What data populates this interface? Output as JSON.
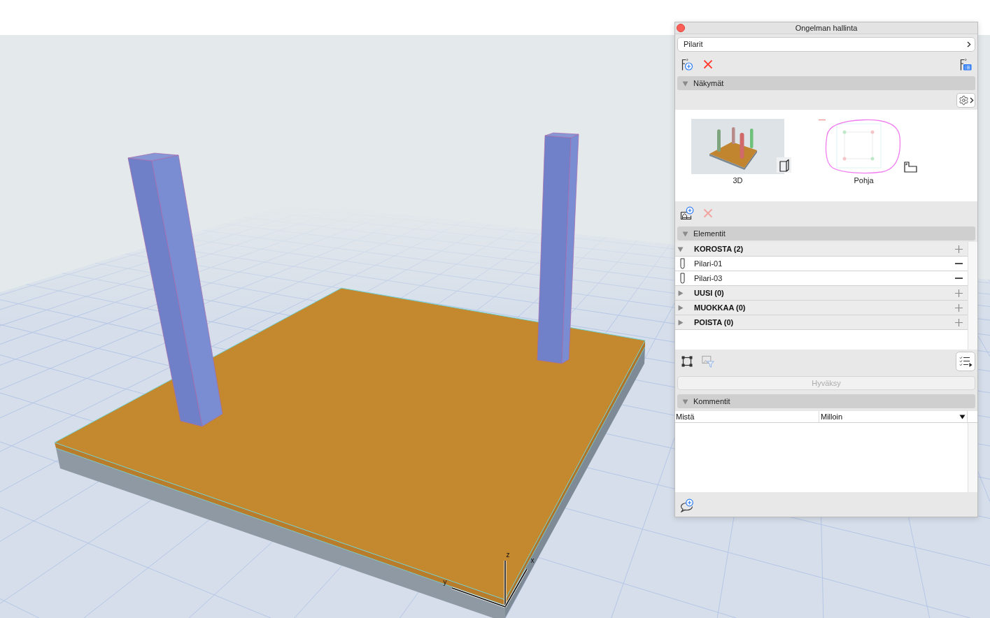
{
  "viewport": {
    "axes": [
      {
        "kind": "z",
        "label": "z"
      },
      {
        "kind": "x",
        "label": "x"
      },
      {
        "kind": "y",
        "label": "y"
      }
    ]
  },
  "panel": {
    "title": "Ongelman hallinta",
    "issue_field": {
      "value": "Pilarit"
    },
    "issue_toolbar": [
      {
        "kind": "new",
        "disabled": false
      },
      {
        "kind": "delete",
        "disabled": false
      },
      {
        "kind": "list",
        "disabled": false
      }
    ],
    "views_section": {
      "title": "Näkymät",
      "expanded": true,
      "views": [
        {
          "kind": "model",
          "label": "3D",
          "selected": false
        },
        {
          "kind": "plan",
          "label": "Pohja",
          "selected": false
        }
      ],
      "toolbar": [
        {
          "kind": "add",
          "disabled": false
        },
        {
          "kind": "delete",
          "disabled": true
        }
      ]
    },
    "elements_section": {
      "title": "Elementit",
      "expanded": true,
      "groups": [
        {
          "label": "KOROSTA (2)",
          "expanded": true,
          "children": [
            {
              "label": "Pilari-01",
              "selected": false
            },
            {
              "label": "Pilari-03",
              "selected": false
            }
          ]
        },
        {
          "label": "UUSI (0)",
          "expanded": false
        },
        {
          "label": "MUOKKAA (0)",
          "expanded": false
        },
        {
          "label": "POISTA (0)",
          "expanded": false
        }
      ],
      "toolbar": [
        {
          "kind": "select",
          "disabled": false
        },
        {
          "kind": "filter",
          "disabled": true
        },
        {
          "kind": "checklist",
          "disabled": false
        }
      ]
    },
    "approve_button": {
      "label": "Hyväksy",
      "disabled": true
    },
    "comments_section": {
      "title": "Kommentit",
      "expanded": true,
      "columns": [
        {
          "label": "Mistä",
          "sorted": false
        },
        {
          "label": "Milloin",
          "sorted": true
        }
      ],
      "toolbar": [
        {
          "kind": "add",
          "disabled": false
        }
      ]
    }
  }
}
